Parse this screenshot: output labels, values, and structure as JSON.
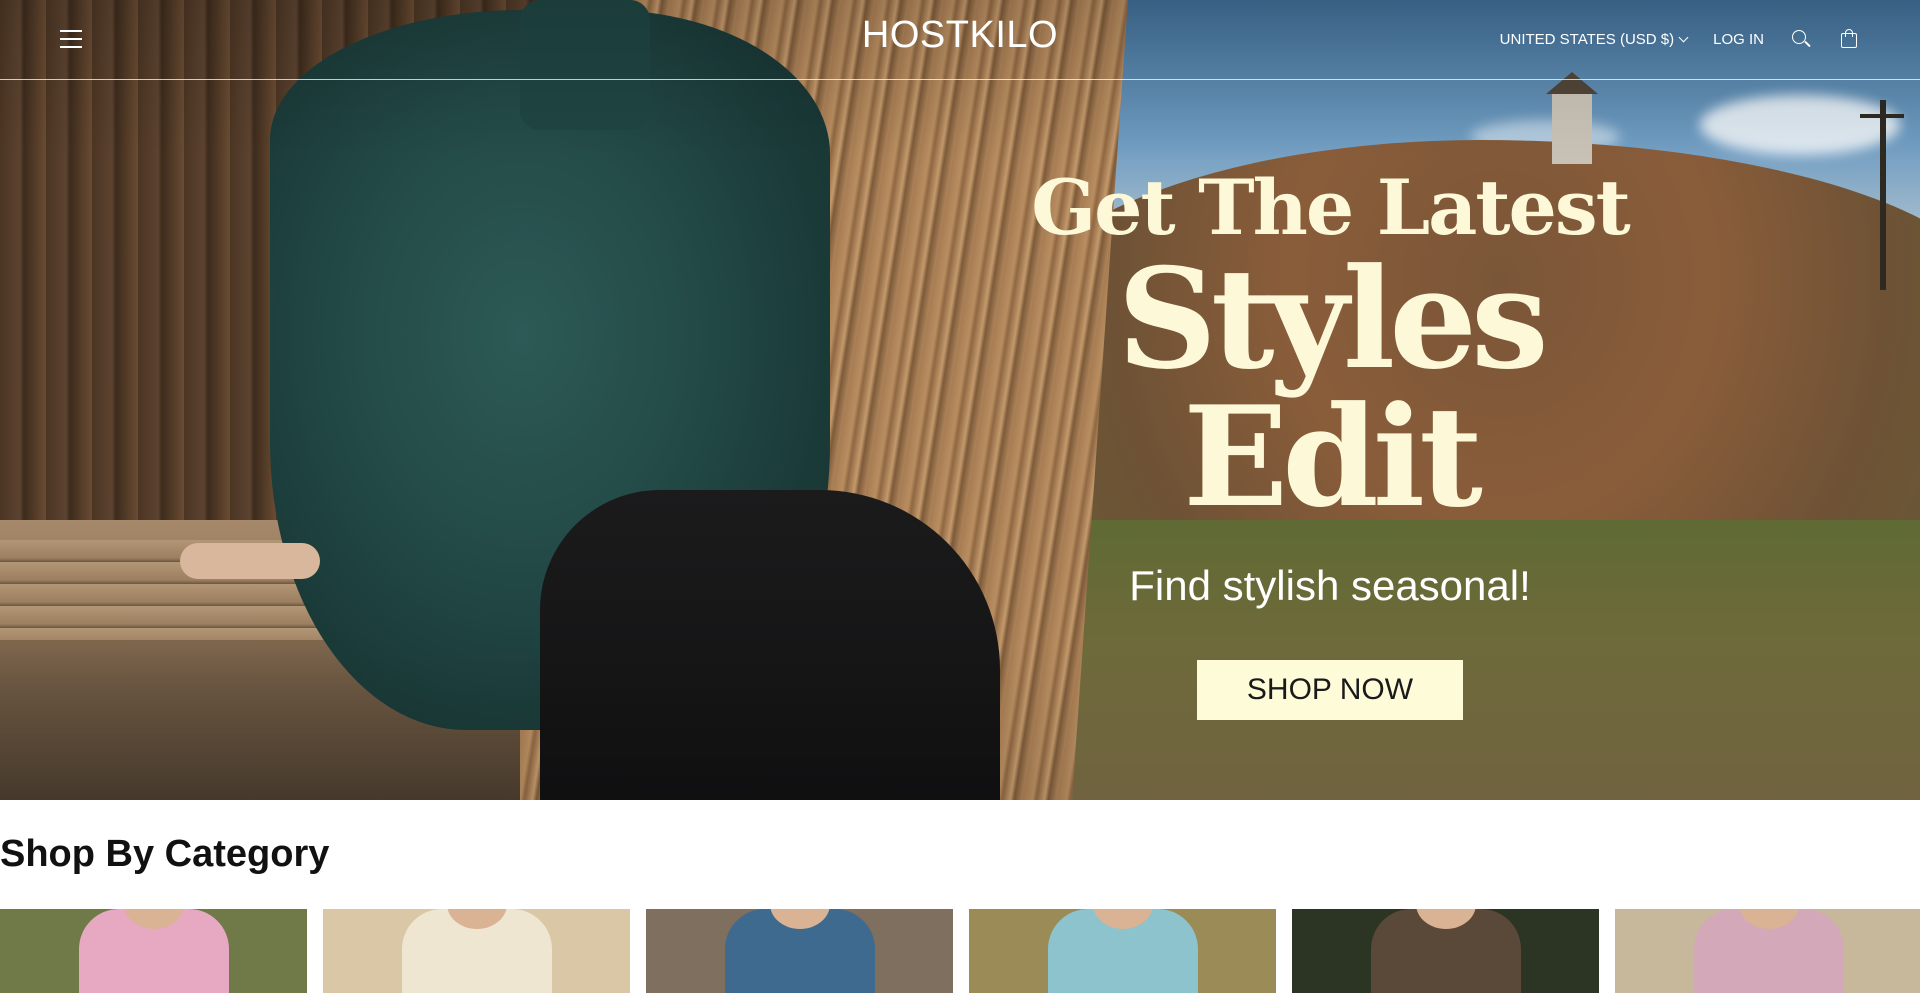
{
  "header": {
    "logo": "HOSTKILO",
    "currency": "UNITED STATES (USD $)",
    "login_label": "LOG IN",
    "icons": [
      "menu-icon",
      "search-icon",
      "cart-icon",
      "chevron-down-icon"
    ]
  },
  "hero": {
    "title_line1": "Get The Latest",
    "title_line2": "Styles Edit",
    "subtitle": "Find stylish seasonal!",
    "cta_label": "SHOP NOW",
    "text_color": "#fdf9d8",
    "button_color": "#fefbd9"
  },
  "categories": {
    "heading": "Shop By Category",
    "cards": [
      {
        "bg": "#6f7a48",
        "garment": "#e7a9c1"
      },
      {
        "bg": "#d9c7a6",
        "garment": "#efe6d2"
      },
      {
        "bg": "#7e6f5e",
        "garment": "#3d6a8e"
      },
      {
        "bg": "#9a8b57",
        "garment": "#8cc3cc"
      },
      {
        "bg": "#2c3424",
        "garment": "#5a4839"
      },
      {
        "bg": "#c7b79b",
        "garment": "#d3a8b9"
      }
    ]
  }
}
